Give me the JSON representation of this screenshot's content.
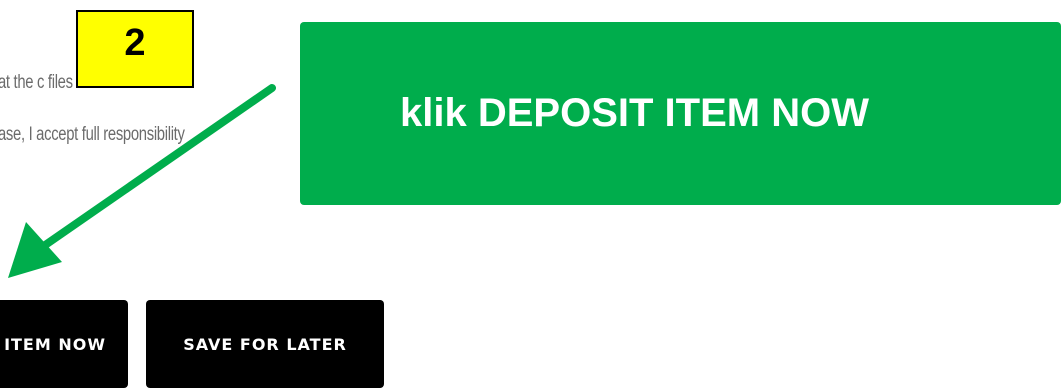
{
  "form": {
    "agreement_line_1": "at the c              files and as",
    "agreement_line_2": "ase, I accept full responsibility",
    "deposit_button_label": "ITEM NOW",
    "save_button_label": "SAVE FOR LATER"
  },
  "annotation": {
    "step_number": "2",
    "callout_text": "klik DEPOSIT ITEM NOW",
    "callout_color": "#00ad4c",
    "badge_color": "#ffff00",
    "arrow_color": "#00ad4c"
  }
}
